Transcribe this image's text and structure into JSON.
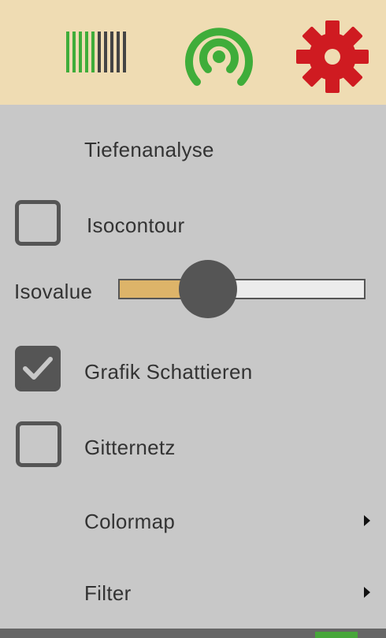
{
  "toolbar": {
    "icons": [
      "barcode-icon",
      "wireless-signal-icon",
      "gear-icon"
    ],
    "colors": {
      "green": "#3fad3a",
      "dark_gray": "#444444",
      "red": "#cf1b21",
      "background": "#efdcb3"
    }
  },
  "menu": {
    "title": "Tiefenanalyse",
    "isocontour": {
      "label": "Isocontour",
      "checked": false
    },
    "isovalue": {
      "label": "Isovalue",
      "value_fraction": 0.36,
      "fill_color": "#ddb469"
    },
    "shade": {
      "label": "Grafik Schattieren",
      "checked": true
    },
    "grid": {
      "label": "Gitternetz",
      "checked": false
    },
    "colormap": {
      "label": "Colormap",
      "icon": "chevron-right-icon"
    },
    "filter": {
      "label": "Filter",
      "icon": "chevron-right-icon"
    }
  }
}
